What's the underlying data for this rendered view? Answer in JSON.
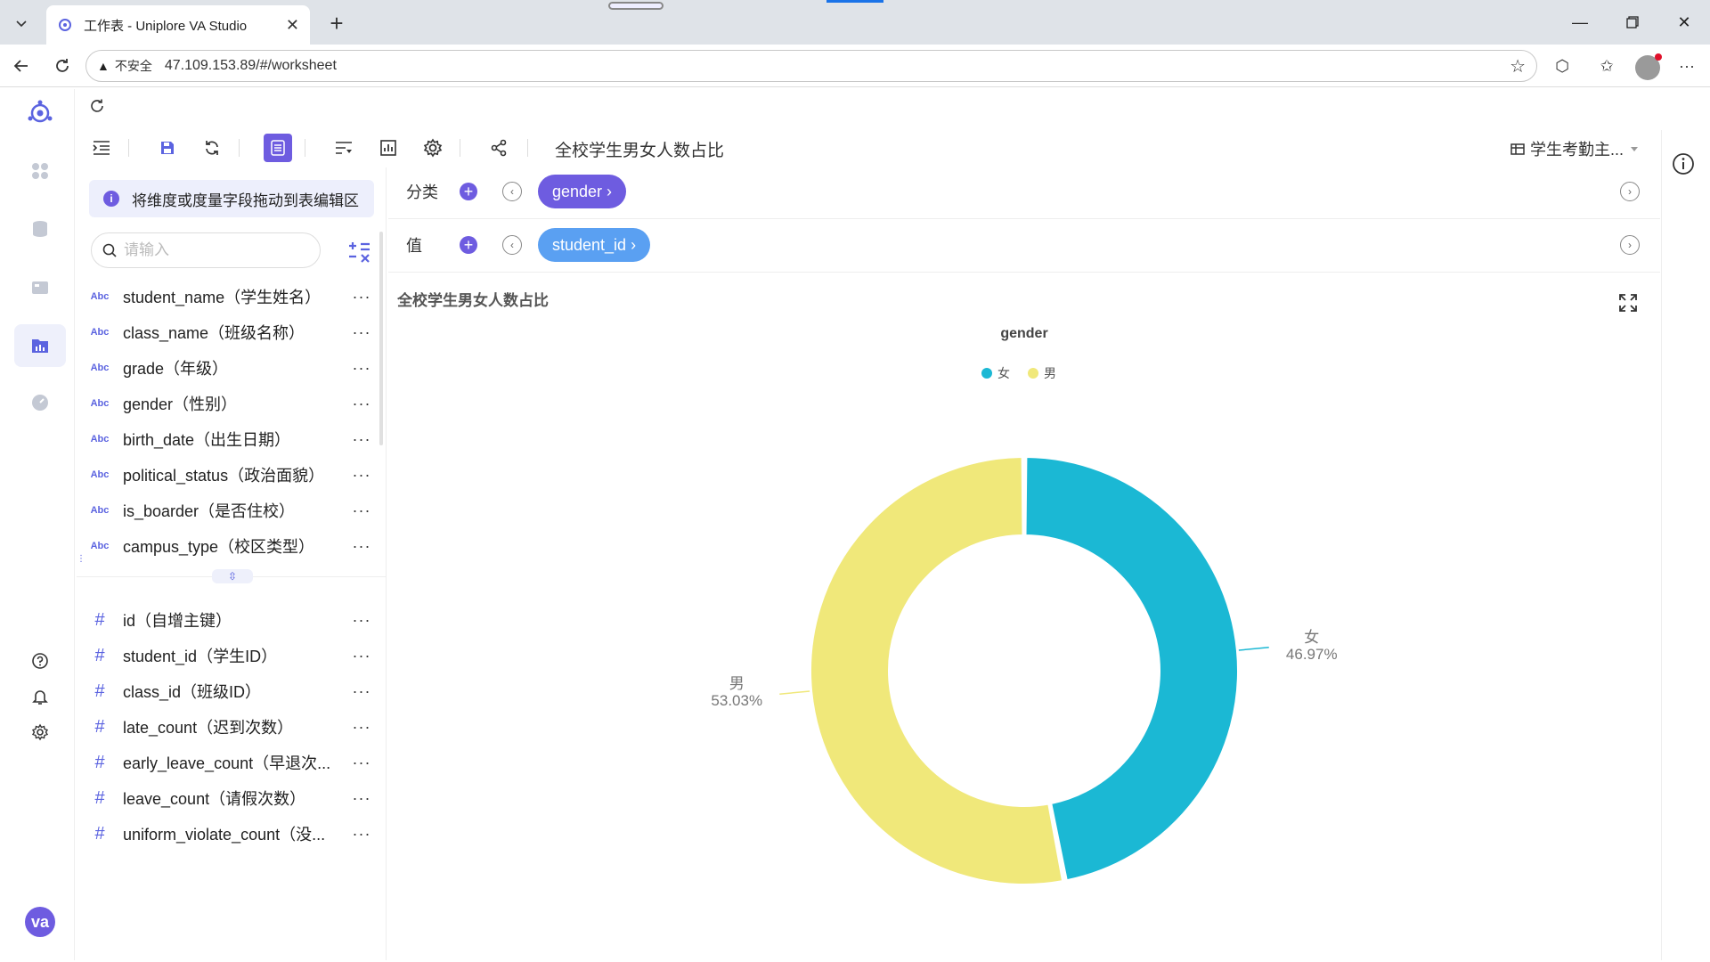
{
  "browser": {
    "tab_title": "工作表 - Uniplore VA Studio",
    "insecure_label": "不安全",
    "url": "47.109.153.89/#/worksheet"
  },
  "toolbar": {
    "worksheet_title": "全校学生男女人数占比",
    "dataset_select": "学生考勤主..."
  },
  "field_panel": {
    "hint": "将维度或度量字段拖动到表编辑区",
    "search_placeholder": "请输入",
    "dimensions": [
      {
        "type": "Abc",
        "label": "student_name（学生姓名）"
      },
      {
        "type": "Abc",
        "label": "class_name（班级名称）"
      },
      {
        "type": "Abc",
        "label": "grade（年级）"
      },
      {
        "type": "Abc",
        "label": "gender（性别）"
      },
      {
        "type": "Abc",
        "label": "birth_date（出生日期）"
      },
      {
        "type": "Abc",
        "label": "political_status（政治面貌）"
      },
      {
        "type": "Abc",
        "label": "is_boarder（是否住校）"
      },
      {
        "type": "Abc",
        "label": "campus_type（校区类型）"
      }
    ],
    "measures": [
      {
        "type": "#",
        "label": "id（自增主键）"
      },
      {
        "type": "#",
        "label": "student_id（学生ID）"
      },
      {
        "type": "#",
        "label": "class_id（班级ID）"
      },
      {
        "type": "#",
        "label": "late_count（迟到次数）"
      },
      {
        "type": "#",
        "label": "early_leave_count（早退次..."
      },
      {
        "type": "#",
        "label": "leave_count（请假次数）"
      },
      {
        "type": "#",
        "label": "uniform_violate_count（没..."
      }
    ],
    "more_glyph": "···"
  },
  "shelves": {
    "category_label": "分类",
    "category_pill": "gender ›",
    "value_label": "值",
    "value_pill": "student_id ›"
  },
  "chart_data": {
    "type": "pie",
    "subtype": "donut",
    "title": "全校学生男女人数占比",
    "legend_title": "gender",
    "legend_position": "top-center",
    "categories": [
      "女",
      "男"
    ],
    "values": [
      46.97,
      53.03
    ],
    "value_labels": [
      "46.97%",
      "53.03%"
    ],
    "colors": [
      "#1bb8d4",
      "#f0e87a"
    ]
  }
}
